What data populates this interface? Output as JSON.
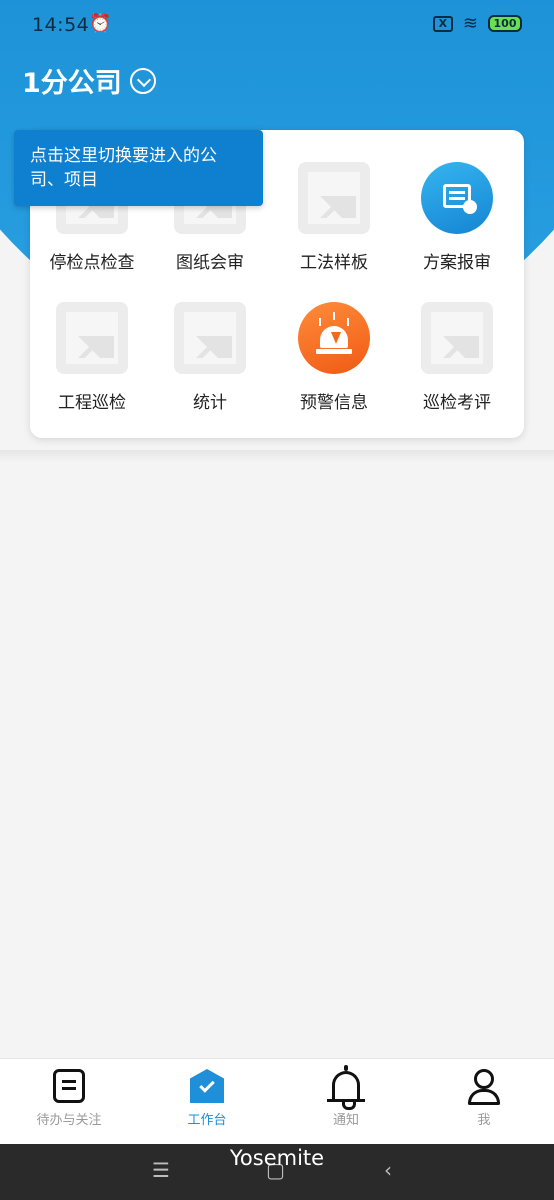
{
  "status_bar": {
    "time": "14:54",
    "sim_label": "X",
    "battery": "100"
  },
  "header": {
    "company": "1分公司"
  },
  "tooltip": {
    "text": "点击这里切换要进入的公司、项目"
  },
  "grid": {
    "items": [
      {
        "label": "停检点检查",
        "icon": "placeholder-image-icon"
      },
      {
        "label": "图纸会审",
        "icon": "placeholder-image-icon"
      },
      {
        "label": "工法样板",
        "icon": "placeholder-image-icon"
      },
      {
        "label": "方案报审",
        "icon": "plan-review-icon"
      },
      {
        "label": "工程巡检",
        "icon": "placeholder-image-icon"
      },
      {
        "label": "统计",
        "icon": "placeholder-image-icon"
      },
      {
        "label": "预警信息",
        "icon": "alarm-light-icon"
      },
      {
        "label": "巡检考评",
        "icon": "placeholder-image-icon"
      }
    ]
  },
  "tabbar": {
    "tabs": [
      {
        "label": "待办与关注",
        "icon": "note-icon",
        "active": false
      },
      {
        "label": "工作台",
        "icon": "workbench-icon",
        "active": true
      },
      {
        "label": "通知",
        "icon": "bell-icon",
        "active": false
      },
      {
        "label": "我",
        "icon": "user-icon",
        "active": false
      }
    ]
  },
  "overlay": {
    "watermark": "Yosemite"
  },
  "colors": {
    "primary": "#1e8fd8",
    "header_gradient_top": "#0a73c3",
    "header_gradient_bottom": "#2aa2e3",
    "alert_orange": "#f05a14"
  }
}
